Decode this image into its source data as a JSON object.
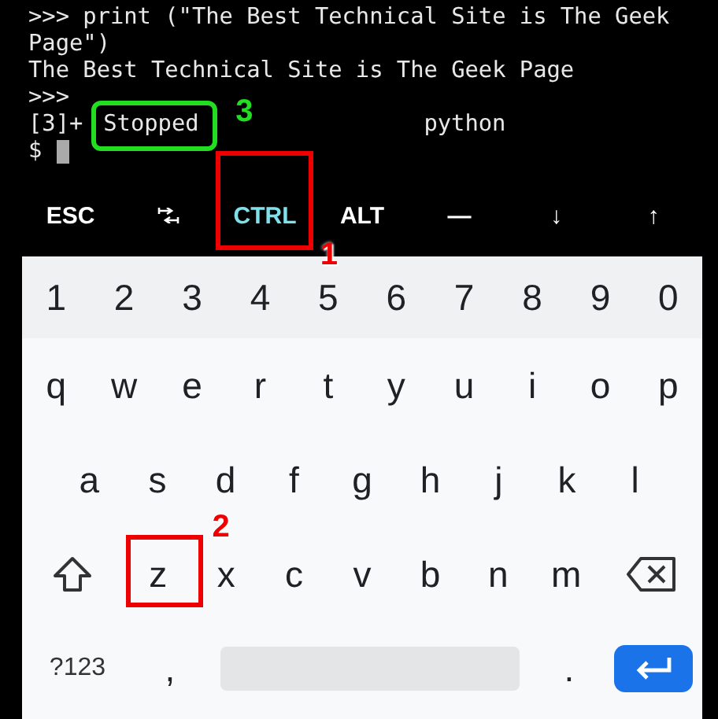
{
  "terminal": {
    "lines": [
      ">>> print (\"The Best Technical Site is The Geek",
      "Page\")",
      "The Best Technical Site is The Geek Page",
      ">>>"
    ],
    "job": {
      "id": "[3]+",
      "status": "Stopped",
      "command": "python",
      "callout": {
        "number": "3",
        "color": "#22dd22"
      }
    },
    "prompt": "$",
    "cursor": true
  },
  "extra_keys": [
    {
      "kind": "text",
      "label": "ESC",
      "on": false
    },
    {
      "kind": "tab-icon",
      "on": false
    },
    {
      "kind": "text",
      "label": "CTRL",
      "on": true,
      "callout": {
        "number": "1",
        "color": "#ee0000"
      }
    },
    {
      "kind": "text",
      "label": "ALT",
      "on": false
    },
    {
      "kind": "text",
      "label": "—",
      "on": false
    },
    {
      "kind": "text",
      "label": "↓",
      "on": false
    },
    {
      "kind": "text",
      "label": "↑",
      "on": false
    }
  ],
  "keyboard": {
    "rows": [
      [
        {
          "kind": "char",
          "label": "1"
        },
        {
          "kind": "char",
          "label": "2"
        },
        {
          "kind": "char",
          "label": "3"
        },
        {
          "kind": "char",
          "label": "4"
        },
        {
          "kind": "char",
          "label": "5"
        },
        {
          "kind": "char",
          "label": "6"
        },
        {
          "kind": "char",
          "label": "7"
        },
        {
          "kind": "char",
          "label": "8"
        },
        {
          "kind": "char",
          "label": "9"
        },
        {
          "kind": "char",
          "label": "0"
        }
      ],
      [
        {
          "kind": "char",
          "label": "q"
        },
        {
          "kind": "char",
          "label": "w"
        },
        {
          "kind": "char",
          "label": "e"
        },
        {
          "kind": "char",
          "label": "r"
        },
        {
          "kind": "char",
          "label": "t"
        },
        {
          "kind": "char",
          "label": "y"
        },
        {
          "kind": "char",
          "label": "u"
        },
        {
          "kind": "char",
          "label": "i"
        },
        {
          "kind": "char",
          "label": "o"
        },
        {
          "kind": "char",
          "label": "p"
        }
      ],
      [
        {
          "kind": "char",
          "label": "a"
        },
        {
          "kind": "char",
          "label": "s"
        },
        {
          "kind": "char",
          "label": "d"
        },
        {
          "kind": "char",
          "label": "f"
        },
        {
          "kind": "char",
          "label": "g"
        },
        {
          "kind": "char",
          "label": "h"
        },
        {
          "kind": "char",
          "label": "j"
        },
        {
          "kind": "char",
          "label": "k"
        },
        {
          "kind": "char",
          "label": "l"
        }
      ],
      [
        {
          "kind": "shift"
        },
        {
          "kind": "char",
          "label": "z",
          "callout": {
            "number": "2",
            "color": "#ee0000"
          }
        },
        {
          "kind": "char",
          "label": "x"
        },
        {
          "kind": "char",
          "label": "c"
        },
        {
          "kind": "char",
          "label": "v"
        },
        {
          "kind": "char",
          "label": "b"
        },
        {
          "kind": "char",
          "label": "n"
        },
        {
          "kind": "char",
          "label": "m"
        },
        {
          "kind": "backspace"
        }
      ],
      [
        {
          "kind": "mode",
          "label": "?123"
        },
        {
          "kind": "char",
          "label": ","
        },
        {
          "kind": "space"
        },
        {
          "kind": "char",
          "label": "."
        },
        {
          "kind": "enter"
        }
      ]
    ]
  }
}
